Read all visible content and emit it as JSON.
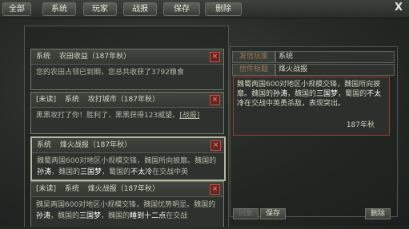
{
  "tabs": [
    {
      "label": "全部"
    },
    {
      "label": "系统"
    },
    {
      "label": "玩家"
    },
    {
      "label": "战报"
    },
    {
      "label": "保存"
    },
    {
      "label": "删除"
    }
  ],
  "close_label": "X",
  "messages": [
    {
      "header": [
        "系统",
        "农田收益（187年秋）"
      ],
      "body": "您的农田占领已到期，您总共收获了3792粮食"
    },
    {
      "header": [
        "[未读]",
        "系统",
        "攻打城市（187年秋）"
      ],
      "body_prefix": "黑黑攻打了你！胜利了，黑黑获得123威望。",
      "body_link": "[战报]"
    },
    {
      "header": [
        "系统",
        "烽火战报（187年秋）"
      ],
      "body_1": "魏蜀两国600对地区小规模交锋，魏国所向披靡。魏国的",
      "hl_1": "孙涛",
      "body_2": "，魏国的",
      "hl_2": "三国梦",
      "body_3": "，蜀国的",
      "hl_3": "不太冷",
      "body_4": "在交战中英"
    },
    {
      "header": [
        "[未读]",
        "系统",
        "烽火战报（187年秋）"
      ],
      "body_1": "魏吴两国600对地区小规模交锋，魏国优势明显。魏国的",
      "hl_1": "孙涛",
      "body_2": "，魏国的",
      "hl_2": "三国梦",
      "body_3": "，魏国的",
      "hl_3": "睡到十二点",
      "body_4": "在交战"
    }
  ],
  "detail": {
    "sender_label": "发信玩家",
    "sender_value": "系统",
    "title_label": "信件标题",
    "title_value": "烽火战报",
    "body_1": "魏蜀两国600对地区小规模交锋，魏国所向披靡。魏国的",
    "hl_1": "孙涛",
    "body_2": "，魏国的",
    "hl_2": "三国梦",
    "body_3": "，蜀国的",
    "hl_3": "不太冷",
    "body_4": "在交战中英勇杀敌，表现突出。",
    "date": "187年秋"
  },
  "buttons": {
    "reply": "回复",
    "save": "保存",
    "delete": "删除"
  }
}
